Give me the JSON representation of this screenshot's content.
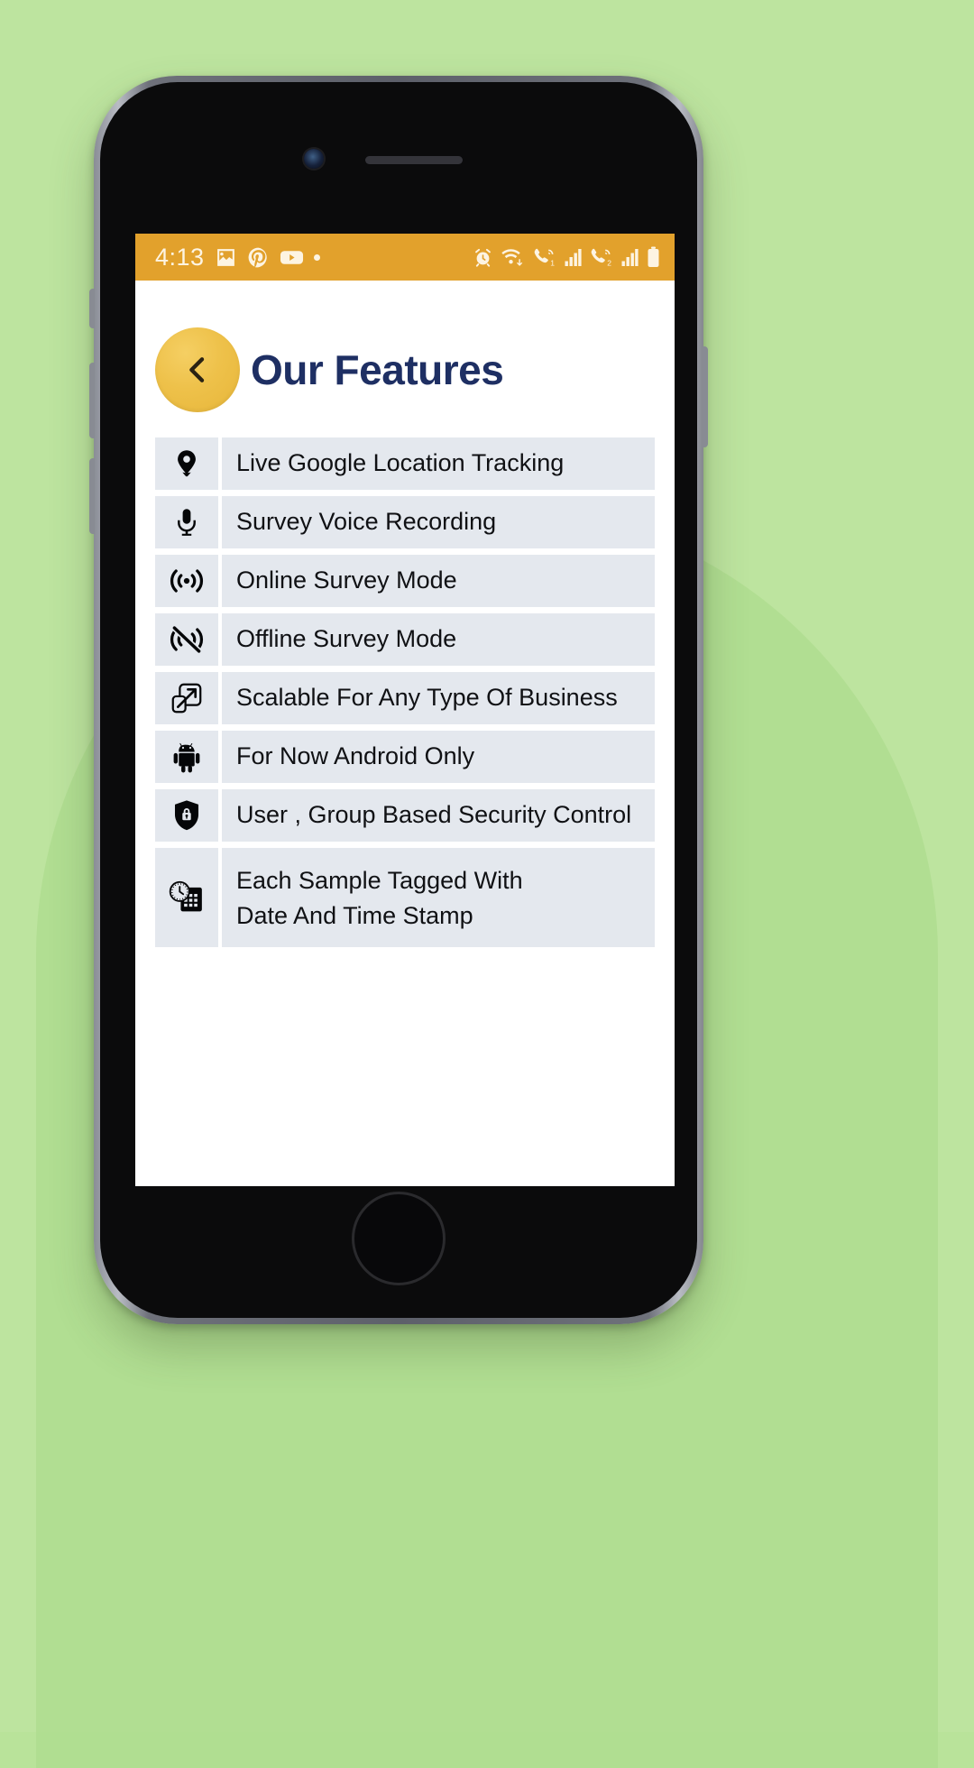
{
  "theme": {
    "background": "#bde49f",
    "status_bar_bg": "#e2a12c",
    "accent": "#eec14a",
    "title_color": "#1e2f63",
    "row_bg": "#e4e8ee"
  },
  "status_bar": {
    "time": "4:13",
    "left_icons": [
      "image-icon",
      "pinterest-icon",
      "youtube-icon",
      "notification-dot"
    ],
    "right_icons": [
      "alarm-icon",
      "wifi-icon",
      "call-signal-1-icon",
      "signal-bars-1-icon",
      "call-signal-2-icon",
      "signal-bars-2-icon",
      "battery-icon"
    ]
  },
  "header": {
    "back_label": "chevron-left-icon",
    "title": "Our Features"
  },
  "features": [
    {
      "icon": "location-pin-icon",
      "label": "Live Google Location Tracking"
    },
    {
      "icon": "microphone-icon",
      "label": "Survey Voice Recording"
    },
    {
      "icon": "broadcast-icon",
      "label": "Online Survey Mode"
    },
    {
      "icon": "broadcast-off-icon",
      "label": "Offline Survey Mode"
    },
    {
      "icon": "scale-expand-icon",
      "label": "Scalable For Any Type Of Business"
    },
    {
      "icon": "android-icon",
      "label": "For Now Android Only"
    },
    {
      "icon": "shield-lock-icon",
      "label": "User , Group Based Security Control"
    },
    {
      "icon": "calendar-clock-icon",
      "label": "Each Sample Tagged With\nDate And Time Stamp"
    }
  ]
}
